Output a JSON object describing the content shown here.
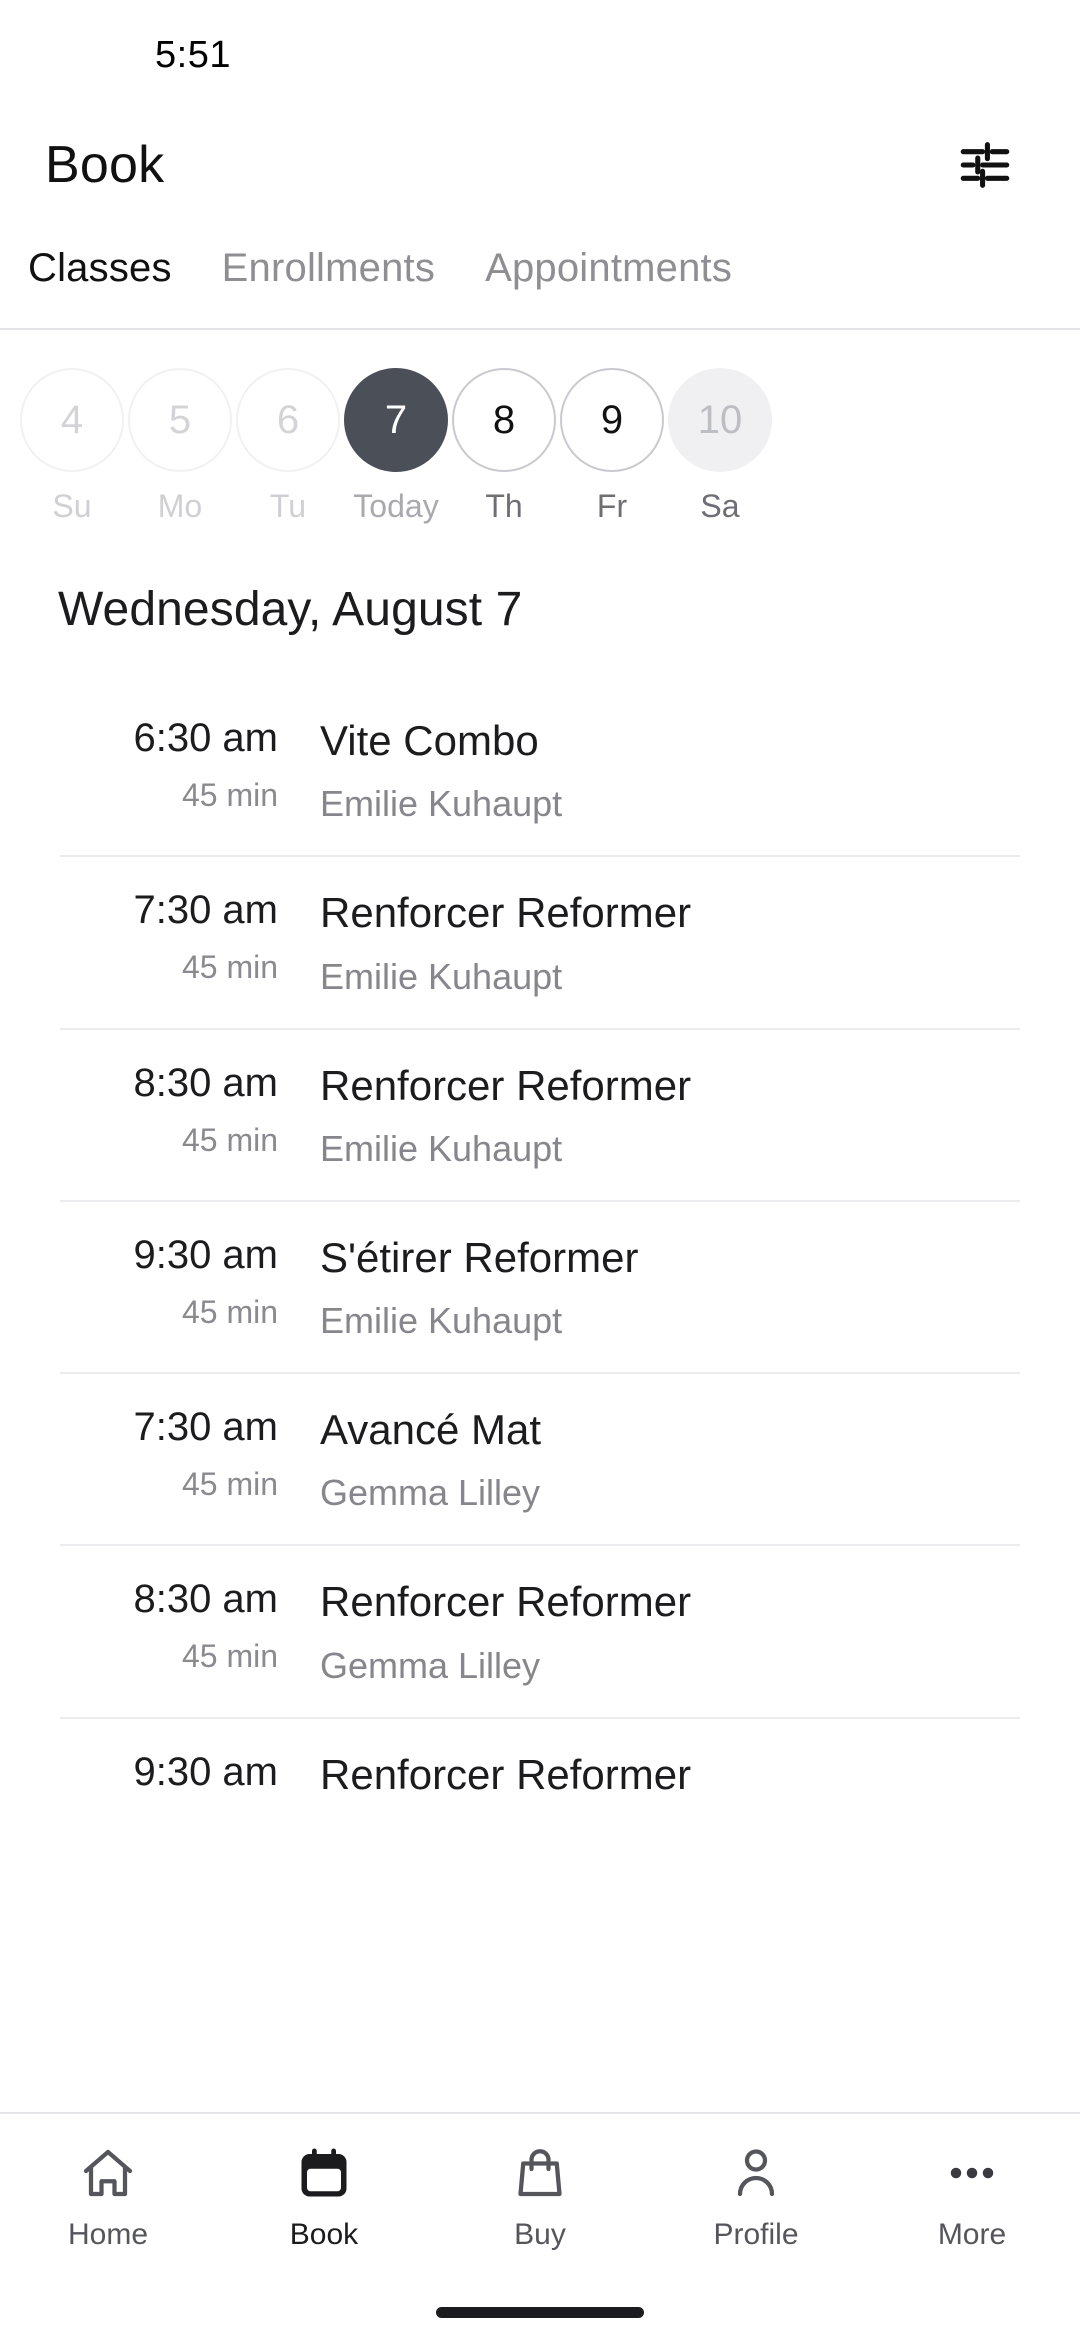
{
  "status": {
    "time": "5:51"
  },
  "header": {
    "title": "Book",
    "filter_icon": "tune-filter-icon"
  },
  "tabs": [
    {
      "label": "Classes",
      "active": true
    },
    {
      "label": "Enrollments",
      "active": false
    },
    {
      "label": "Appointments",
      "active": false
    }
  ],
  "date_strip": [
    {
      "day": "4",
      "weekday": "Su",
      "state": "disabled"
    },
    {
      "day": "5",
      "weekday": "Mo",
      "state": "disabled"
    },
    {
      "day": "6",
      "weekday": "Tu",
      "state": "disabled"
    },
    {
      "day": "7",
      "weekday": "Today",
      "state": "selected"
    },
    {
      "day": "8",
      "weekday": "Th",
      "state": "available"
    },
    {
      "day": "9",
      "weekday": "Fr",
      "state": "available"
    },
    {
      "day": "10",
      "weekday": "Sa",
      "state": "muted"
    }
  ],
  "day_heading": "Wednesday, August 7",
  "classes": [
    {
      "time": "6:30 am",
      "duration": "45 min",
      "name": "Vite Combo",
      "instructor": "Emilie Kuhaupt"
    },
    {
      "time": "7:30 am",
      "duration": "45 min",
      "name": "Renforcer Reformer",
      "instructor": "Emilie Kuhaupt"
    },
    {
      "time": "8:30 am",
      "duration": "45 min",
      "name": "Renforcer Reformer",
      "instructor": "Emilie Kuhaupt"
    },
    {
      "time": "9:30 am",
      "duration": "45 min",
      "name": "S'étirer Reformer",
      "instructor": "Emilie Kuhaupt"
    },
    {
      "time": "7:30 am",
      "duration": "45 min",
      "name": "Avancé Mat",
      "instructor": "Gemma Lilley"
    },
    {
      "time": "8:30 am",
      "duration": "45 min",
      "name": "Renforcer Reformer",
      "instructor": "Gemma Lilley"
    },
    {
      "time": "9:30 am",
      "duration": "",
      "name": "Renforcer Reformer",
      "instructor": ""
    }
  ],
  "bottom_nav": [
    {
      "label": "Home",
      "icon": "house-icon",
      "active": false
    },
    {
      "label": "Book",
      "icon": "calendar-icon",
      "active": true
    },
    {
      "label": "Buy",
      "icon": "shopping-bag-icon",
      "active": false
    },
    {
      "label": "Profile",
      "icon": "person-icon",
      "active": false
    },
    {
      "label": "More",
      "icon": "ellipsis-icon",
      "active": false
    }
  ],
  "colors": {
    "selected_day": "#4b4f58",
    "text_primary": "#1c1c1e",
    "text_secondary": "#86868c",
    "divider": "#ececee"
  }
}
